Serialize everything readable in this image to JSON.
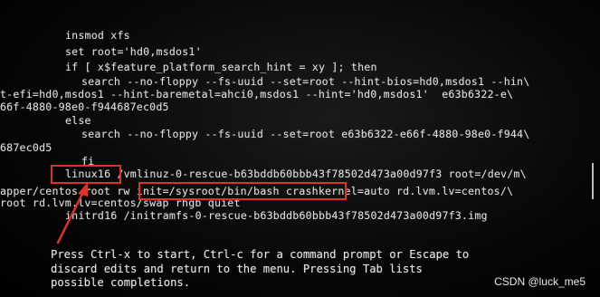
{
  "editor": {
    "lines": [
      "insmod xfs",
      "set root='hd0,msdos1'",
      "if [ x$feature_platform_search_hint = xy ]; then",
      "search --no-floppy --fs-uuid --set=root --hint-bios=hd0,msdos1 --hin\\",
      "t-efi=hd0,msdos1 --hint-baremetal=ahci0,msdos1 --hint='hd0,msdos1'  e63b6322-e\\",
      "66f-4880-98e0-f944687ec0d5",
      "else",
      "search --no-floppy --fs-uuid --set=root e63b6322-e66f-4880-98e0-f944\\",
      "687ec0d5",
      "fi",
      "linux16 /vmlinuz-0-rescue-b63bddb60bbb43f78502d473a00d97f3 root=/dev/m\\",
      "apper/centos-root rw init=/sysroot/bin/bash crashkernel=auto rd.lvm.lv=centos/\\",
      "root rd.lvm.lv=centos/swap rhgb quiet",
      "initrd16 /initramfs-0-rescue-b63bddb60bbb43f78502d473a00d97f3.img"
    ]
  },
  "help_text": [
    "Press Ctrl-x to start, Ctrl-c for a command prompt or Escape to",
    "discard edits and return to the menu. Pressing Tab lists",
    "possible completions."
  ],
  "watermark": "CSDN @luck_me5",
  "annotation_color": "#e0302a"
}
